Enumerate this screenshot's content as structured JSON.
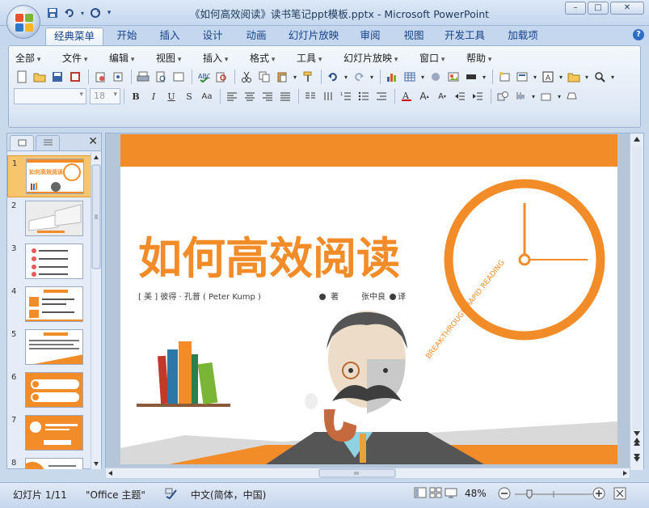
{
  "window": {
    "title": "《如何高效阅读》读书笔记ppt模板.pptx - Microsoft PowerPoint",
    "minimize": "–",
    "maximize": "□",
    "close": "✕"
  },
  "ribbon_tabs": [
    "经典菜单",
    "开始",
    "插入",
    "设计",
    "动画",
    "幻灯片放映",
    "审阅",
    "视图",
    "开发工具",
    "加载项"
  ],
  "classic_menu": [
    "全部",
    "文件",
    "编辑",
    "视图",
    "插入",
    "格式",
    "工具",
    "幻灯片放映",
    "窗口",
    "帮助"
  ],
  "font_size": "18",
  "help_icon": "?",
  "slide_pane": {
    "close_icon": "✕",
    "thumbnails": [
      "1",
      "2",
      "3",
      "4",
      "5",
      "6",
      "7",
      "8"
    ]
  },
  "slide": {
    "title": "如何高效阅读",
    "author_line": "[ 美 ] 彼得 · 孔普 ( Peter Kump )",
    "author_role": "著",
    "translator_line": "张中良",
    "translator_role": "译",
    "arc_text": "BREAK-THROUGH RAPID READING",
    "colors": {
      "orange": "#f28c28",
      "dark": "#3e3e3e",
      "grey": "#8a8a8a"
    }
  },
  "status": {
    "slide_counter": "幻灯片 1/11",
    "theme": "\"Office 主题\"",
    "language": "中文(简体，中国)",
    "zoom": "48%"
  }
}
